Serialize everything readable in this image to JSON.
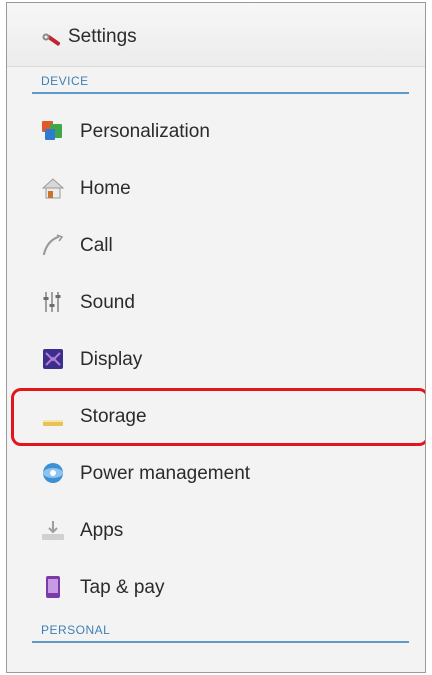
{
  "header": {
    "title": "Settings",
    "icon": "settings-icon"
  },
  "sections": {
    "device": "DEVICE",
    "personal": "PERSONAL"
  },
  "items": [
    {
      "label": "Personalization",
      "icon": "personalization-icon"
    },
    {
      "label": "Home",
      "icon": "home-icon"
    },
    {
      "label": "Call",
      "icon": "call-icon"
    },
    {
      "label": "Sound",
      "icon": "sound-icon"
    },
    {
      "label": "Display",
      "icon": "display-icon"
    },
    {
      "label": "Storage",
      "icon": "storage-icon"
    },
    {
      "label": "Power management",
      "icon": "power-management-icon"
    },
    {
      "label": "Apps",
      "icon": "apps-icon"
    },
    {
      "label": "Tap & pay",
      "icon": "tap-and-pay-icon"
    }
  ],
  "highlight": {
    "target": "Storage",
    "color": "#e4141b"
  },
  "colors": {
    "section_accent": "#3f7fb4",
    "background": "#f3f3f3",
    "text": "#2b2b2b"
  }
}
